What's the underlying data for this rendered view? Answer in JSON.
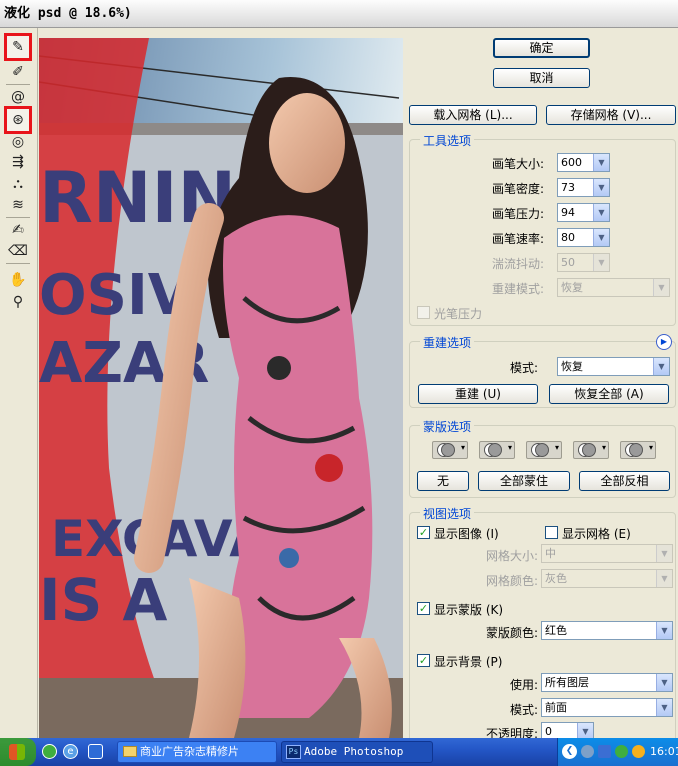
{
  "window": {
    "title": "液化 psd @ 18.6%)"
  },
  "tools": [
    "forward-warp",
    "reconstruct",
    "twirl-clockwise",
    "pucker",
    "bloat",
    "push-left",
    "mirror",
    "turbulence",
    "freeze-mask",
    "thaw-mask",
    "hand",
    "zoom"
  ],
  "buttons": {
    "ok": "确定",
    "cancel": "取消",
    "load_mesh": "载入网格 (L)...",
    "save_mesh": "存储网格 (V)..."
  },
  "tool_options": {
    "title": "工具选项",
    "brush_size": {
      "label": "画笔大小:",
      "value": "600"
    },
    "brush_density": {
      "label": "画笔密度:",
      "value": "73"
    },
    "brush_pressure": {
      "label": "画笔压力:",
      "value": "94"
    },
    "brush_rate": {
      "label": "画笔速率:",
      "value": "80"
    },
    "turbulent_jitter": {
      "label": "湍流抖动:",
      "value": "50"
    },
    "reconstruct_mode": {
      "label": "重建模式:",
      "value": "恢复"
    },
    "stylus_pressure": "光笔压力"
  },
  "reconstruct_options": {
    "title": "重建选项",
    "mode_label": "模式:",
    "mode_value": "恢复",
    "reconstruct_btn": "重建 (U)",
    "restore_all_btn": "恢复全部 (A)"
  },
  "mask_options": {
    "title": "蒙版选项",
    "none": "无",
    "mask_all": "全部蒙住",
    "invert_all": "全部反相"
  },
  "view_options": {
    "title": "视图选项",
    "show_image": "显示图像 (I)",
    "show_mesh": "显示网格 (E)",
    "mesh_size": {
      "label": "网格大小:",
      "value": "中"
    },
    "mesh_color": {
      "label": "网格颜色:",
      "value": "灰色"
    },
    "show_mask": "显示蒙版 (K)",
    "mask_color": {
      "label": "蒙版颜色:",
      "value": "红色"
    },
    "show_backdrop": "显示背景 (P)",
    "use": {
      "label": "使用:",
      "value": "所有图层"
    },
    "mode": {
      "label": "模式:",
      "value": "前面"
    },
    "opacity": {
      "label": "不透明度:",
      "value": "0"
    }
  },
  "canvas_sign": [
    "RNIN",
    "OSIV",
    "AZAR",
    "EXCAVA",
    "IS A"
  ],
  "taskbar": {
    "folder_btn": "商业广告杂志精修片",
    "ps_btn": "Adobe Photoshop",
    "clock": "16:01"
  },
  "colors": {
    "highlight": "#e8141a",
    "group_title": "#0046d5",
    "mask_red": "#d8282c"
  }
}
